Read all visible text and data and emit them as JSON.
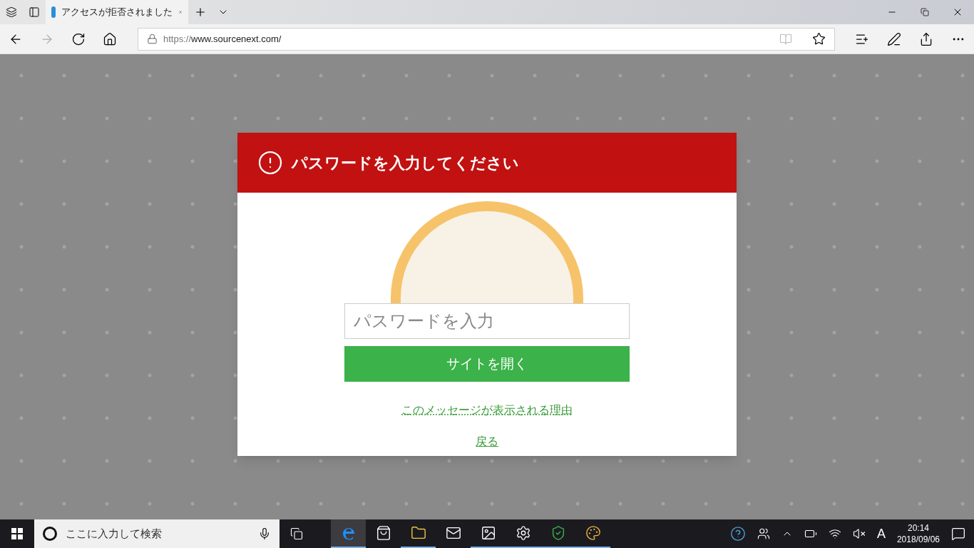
{
  "tab": {
    "title": "アクセスが拒否されました"
  },
  "address_bar": {
    "scheme": "https://",
    "host": "www.sourcenext.com/"
  },
  "dialog": {
    "title": "パスワードを入力してください",
    "password_field": {
      "placeholder": "パスワードを入力"
    },
    "submit_button": "サイトを開く",
    "links": [
      "このメッセージが表示される理由",
      "戻る"
    ]
  },
  "taskbar": {
    "search": {
      "placeholder": "ここに入力して検索"
    },
    "apps": [
      {
        "kind": "edge",
        "running": true,
        "active": true
      },
      {
        "kind": "store",
        "running": false,
        "active": false
      },
      {
        "kind": "explorer",
        "running": true,
        "active": false
      },
      {
        "kind": "mail",
        "running": false,
        "active": false
      },
      {
        "kind": "photos",
        "running": true,
        "active": false
      },
      {
        "kind": "settings",
        "running": true,
        "active": false
      },
      {
        "kind": "shield",
        "running": true,
        "active": false
      },
      {
        "kind": "paint",
        "running": true,
        "active": false
      }
    ],
    "ime": "A",
    "time": "20:14",
    "date": "2018/09/06"
  }
}
